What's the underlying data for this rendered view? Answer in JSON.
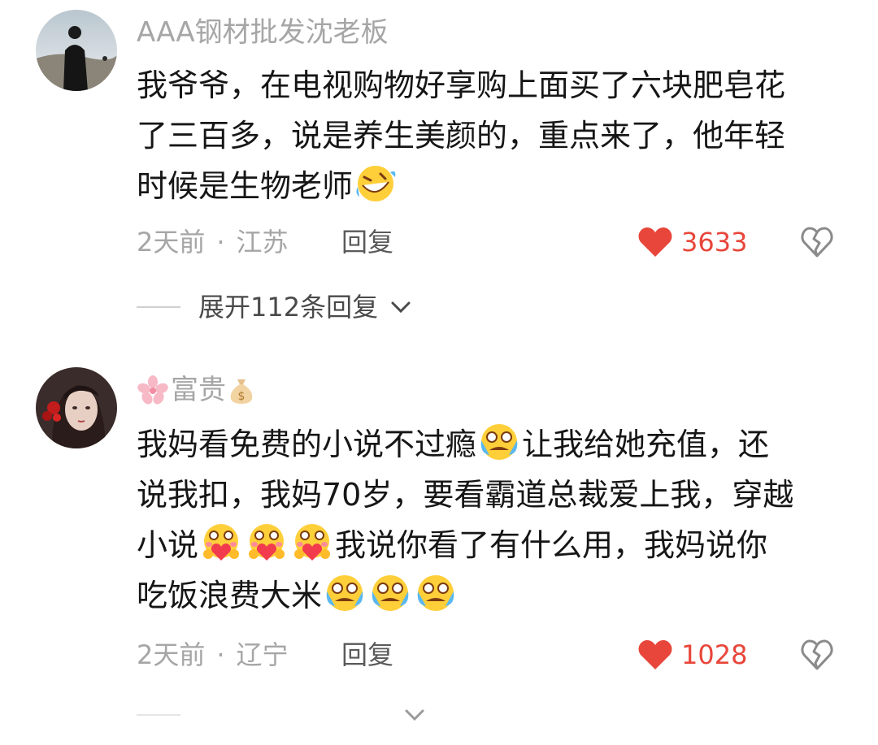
{
  "comments": [
    {
      "username": "AAA钢材批发沈老板",
      "lines": [
        "我爷爷，在电视购物好享购上面买了六块肥皂花",
        "了三百多，说是养生美颜的，重点来了，他年轻",
        "时候是生物老师"
      ],
      "time": "2天前",
      "location": "江苏",
      "reply_label": "回复",
      "likes": "3633",
      "expand_label": "展开112条回复"
    },
    {
      "username": "富贵",
      "line1_a": "我妈看免费的小说不过瘾",
      "line1_b": "让我给她充值，还",
      "line2": "说我扣，我妈70岁，要看霸道总裁爱上我，穿越",
      "line3_a": "小说",
      "line3_b": "我说你看了有什么用，我妈说你",
      "line4_a": "吃饭浪费大米",
      "time": "2天前",
      "location": "辽宁",
      "reply_label": "回复",
      "likes": "1028"
    }
  ],
  "icons": {
    "like": "heart-icon",
    "dislike": "broken-heart-icon",
    "expand": "chevron-down-icon",
    "emoji_laugh": "rolling-laughing-emoji",
    "emoji_cry": "crying-emoji",
    "emoji_love": "hugging-heart-emoji"
  },
  "colors": {
    "accent_red": "#e8463a",
    "meta_gray": "#a6a6a6",
    "text": "#161616"
  }
}
